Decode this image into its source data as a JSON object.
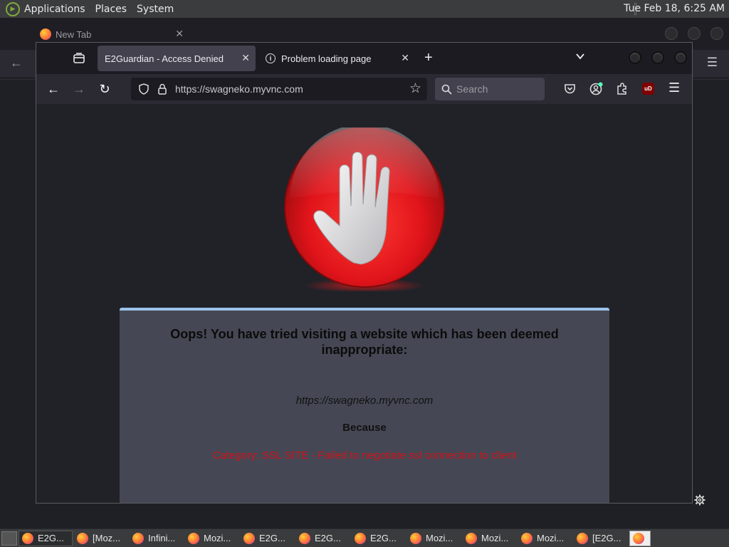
{
  "top_panel": {
    "menus": [
      "Applications",
      "Places",
      "System"
    ],
    "clock": "Tue Feb 18,  6:25 AM"
  },
  "background_window": {
    "tab_title": "New Tab"
  },
  "browser": {
    "tabs": [
      {
        "title": "E2Guardian - Access Denied",
        "active": true
      },
      {
        "title": "Problem loading page",
        "active": false
      }
    ],
    "url": "https://swagneko.myvnc.com",
    "search_placeholder": "Search",
    "extension_badge": "uD"
  },
  "page": {
    "heading": "Oops! You have tried visiting a website which has been deemed inappropriate:",
    "blocked_url": "https://swagneko.myvnc.com",
    "because": "Because",
    "reason": "Category: SSL SITE - Failed to negotiate ssl connection to client"
  },
  "taskbar": {
    "tasks": [
      "E2G...",
      "[Moz...",
      "Infini...",
      "Mozi...",
      "E2G...",
      "E2G...",
      "E2G...",
      "Mozi...",
      "Mozi...",
      "Mozi...",
      "[E2G..."
    ]
  },
  "colors": {
    "panel_accent": "#9cc3ea",
    "reason_text": "#d0131b",
    "stop_red": "#e0141a"
  }
}
